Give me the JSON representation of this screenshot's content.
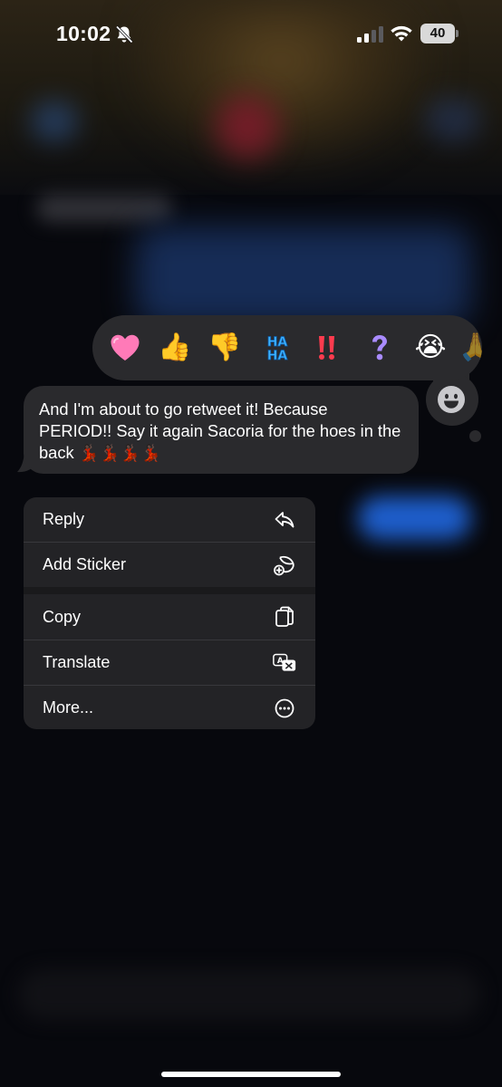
{
  "status_bar": {
    "time": "10:02",
    "battery": "40",
    "icons": [
      "bell-slash-icon",
      "cellular-signal-icon",
      "wifi-icon",
      "battery-icon"
    ]
  },
  "reactions": [
    {
      "name": "heart",
      "glyph": "🩷"
    },
    {
      "name": "thumbs-up",
      "glyph": "👍"
    },
    {
      "name": "thumbs-down",
      "glyph": "👎"
    },
    {
      "name": "haha",
      "glyph": "HA HA"
    },
    {
      "name": "exclamation",
      "glyph": "‼️"
    },
    {
      "name": "question",
      "glyph": "❓"
    },
    {
      "name": "crying",
      "glyph": "😭"
    },
    {
      "name": "partial",
      "glyph": "🙏"
    }
  ],
  "message": {
    "text": "And I'm about to go retweet it! Because PERIOD!! Say it again Sacoria for the hoes in the back",
    "emojis": "💃🏿💃🏿💃🏿💃🏿"
  },
  "menu": {
    "items": [
      {
        "label": "Reply",
        "icon": "reply-icon"
      },
      {
        "label": "Add Sticker",
        "icon": "add-sticker-icon"
      },
      {
        "label": "Copy",
        "icon": "copy-icon"
      },
      {
        "label": "Translate",
        "icon": "translate-icon"
      },
      {
        "label": "More...",
        "icon": "more-icon"
      }
    ]
  },
  "colors": {
    "background": "#07080d",
    "bubble": "#2a2a2d",
    "menu": "#232326",
    "accent_blue": "#1f63d6"
  }
}
